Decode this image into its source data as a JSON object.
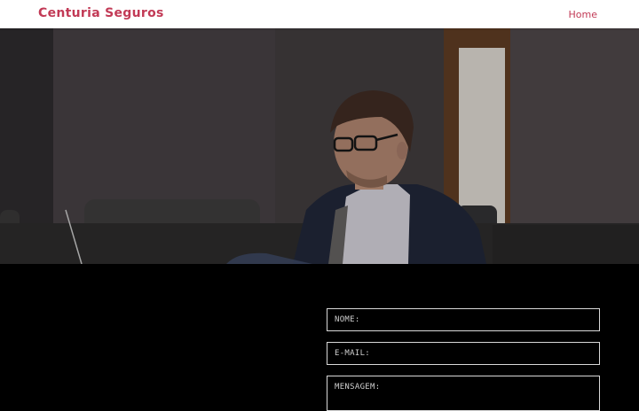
{
  "navbar": {
    "brand": "Centuria Seguros",
    "links": [
      {
        "label": "Home"
      }
    ]
  },
  "hero": {
    "image": "photo of a man with glasses using a laptop on a sofa"
  },
  "contact_form": {
    "fields": [
      {
        "placeholder": "NOME:"
      },
      {
        "placeholder": "E-MAIL:"
      },
      {
        "placeholder": "MENSAGEM:"
      }
    ]
  },
  "colors": {
    "accent": "#c23a56",
    "nav_background": "#ffffff",
    "section_background": "#000000",
    "field_border": "#d8d8d8"
  }
}
